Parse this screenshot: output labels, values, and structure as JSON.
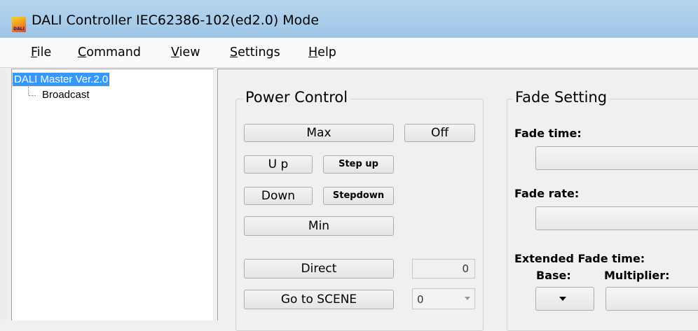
{
  "window": {
    "title": "DALI Controller IEC62386-102(ed2.0) Mode",
    "icon_text": "DALI",
    "icon": "dali-app-icon"
  },
  "menu": [
    {
      "key": "F",
      "rest": "ile"
    },
    {
      "key": "C",
      "rest": "ommand"
    },
    {
      "key": "V",
      "rest": "iew"
    },
    {
      "key": "S",
      "rest": "ettings"
    },
    {
      "key": "H",
      "rest": "elp"
    }
  ],
  "tree": {
    "root": "DALI Master Ver.2.0",
    "child": "Broadcast"
  },
  "power_control": {
    "title": "Power Control",
    "max": "Max",
    "off": "Off",
    "up": "U p",
    "step_up": "Step up",
    "down": "Down",
    "step_down": "Stepdown",
    "min": "Min",
    "direct": "Direct",
    "direct_value": "0",
    "go_to_scene": "Go to SCENE",
    "scene_value": "0"
  },
  "fade_setting": {
    "title": "Fade Setting",
    "fade_time_label": "Fade time:",
    "fade_rate_label": "Fade rate:",
    "extended_label": "Extended Fade time:",
    "base_label": "Base:",
    "multiplier_label": "Multiplier:"
  },
  "colors": {
    "titlebar": "#a9cdea",
    "selection": "#3399ff",
    "background": "#f0f0f0"
  }
}
